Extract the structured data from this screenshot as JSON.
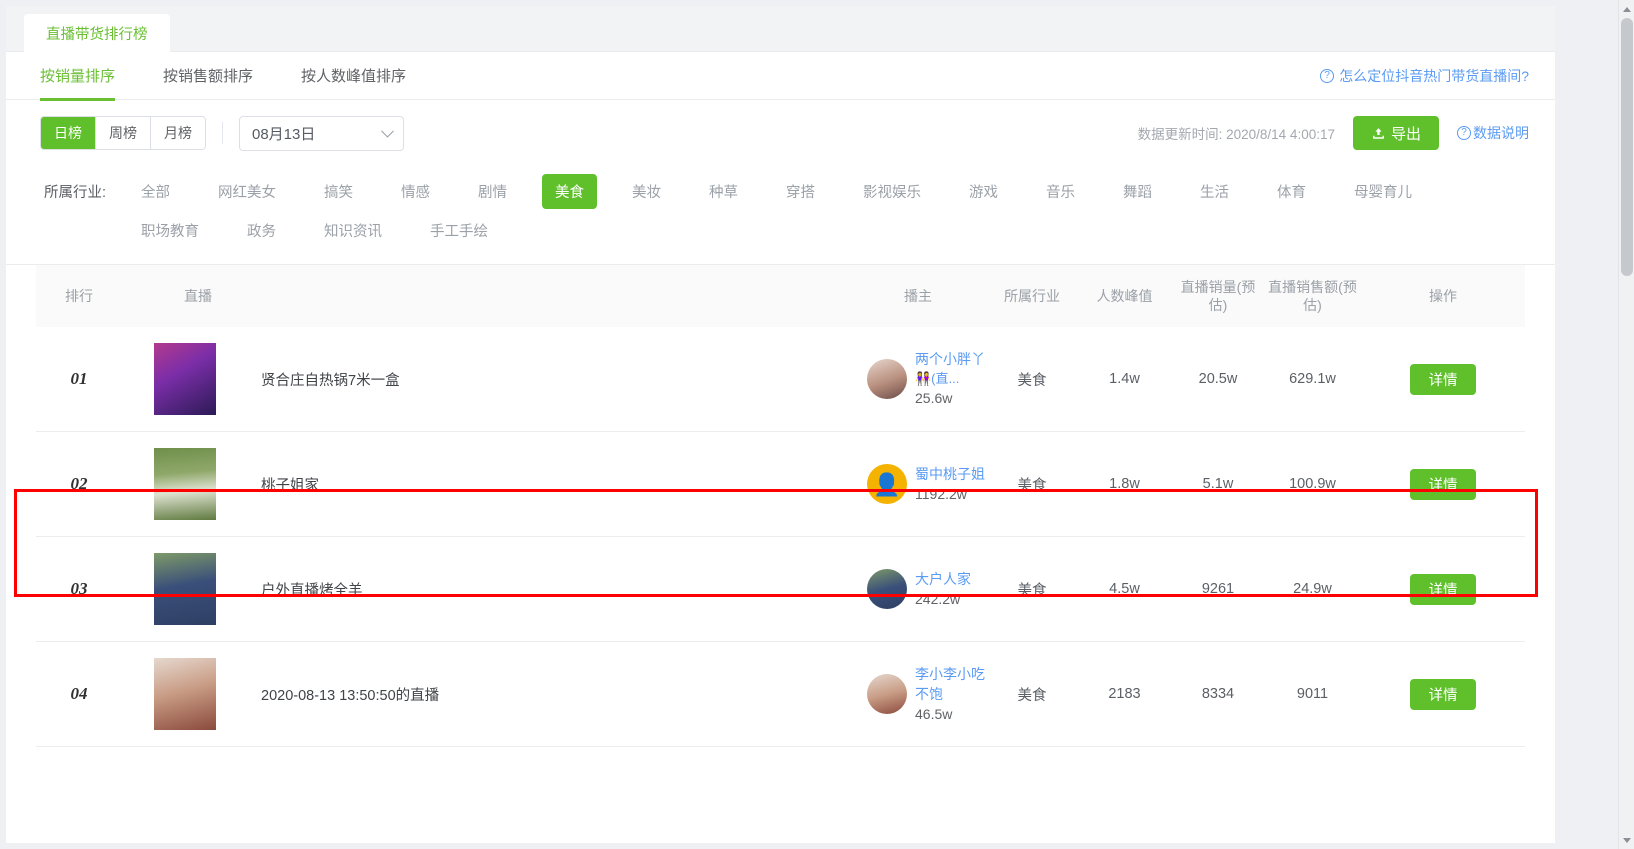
{
  "tab": {
    "label": "直播带货排行榜"
  },
  "sort_tabs": [
    {
      "label": "按销量排序",
      "active": true
    },
    {
      "label": "按销售额排序",
      "active": false
    },
    {
      "label": "按人数峰值排序",
      "active": false
    }
  ],
  "help_link": {
    "icon": "question-circle-icon",
    "label": "怎么定位抖音热门带货直播间?"
  },
  "period": {
    "options": [
      "日榜",
      "周榜",
      "月榜"
    ],
    "selected": "日榜"
  },
  "date_select": {
    "value": "08月13日",
    "icon": "chevron-down-icon"
  },
  "update_time": {
    "label": "数据更新时间:",
    "value": "2020/8/14 4:00:17"
  },
  "export_button": {
    "label": "导出",
    "icon": "upload-icon"
  },
  "data_note": {
    "label": "数据说明",
    "icon": "question-circle-icon"
  },
  "industry_filter": {
    "label": "所属行业:",
    "selected": "美食",
    "items": [
      "全部",
      "网红美女",
      "搞笑",
      "情感",
      "剧情",
      "美食",
      "美妆",
      "种草",
      "穿搭",
      "影视娱乐",
      "游戏",
      "音乐",
      "舞蹈",
      "生活",
      "体育",
      "母婴育儿",
      "职场教育",
      "政务",
      "知识资讯",
      "手工手绘"
    ]
  },
  "table": {
    "headers": {
      "rank": "排行",
      "live": "直播",
      "host": "播主",
      "industry": "所属行业",
      "peak": "人数峰值",
      "volume": "直播销量(预估)",
      "sales": "直播销售额(预估)",
      "action": "操作"
    },
    "action_label": "详情",
    "rows": [
      {
        "rank": "01",
        "title": "贤合庄自热锅7米一盒",
        "host_name": "两个小胖丫",
        "host_extra": "👭(直...",
        "host_fans": "25.6w",
        "industry": "美食",
        "peak": "1.4w",
        "volume": "20.5w",
        "sales": "629.1w",
        "highlighted": false
      },
      {
        "rank": "02",
        "title": "桃子姐家",
        "host_name": "蜀中桃子姐",
        "host_extra": "",
        "host_fans": "1192.2w",
        "industry": "美食",
        "peak": "1.8w",
        "volume": "5.1w",
        "sales": "100.9w",
        "highlighted": true
      },
      {
        "rank": "03",
        "title": "户外直播烤全羊",
        "host_name": "大户人家",
        "host_extra": "",
        "host_fans": "242.2w",
        "industry": "美食",
        "peak": "4.5w",
        "volume": "9261",
        "sales": "24.9w",
        "highlighted": false
      },
      {
        "rank": "04",
        "title": "2020-08-13 13:50:50的直播",
        "host_name": "李小李小吃",
        "host_extra": "不饱",
        "host_fans": "46.5w",
        "industry": "美食",
        "peak": "2183",
        "volume": "8334",
        "sales": "9011",
        "highlighted": false
      }
    ]
  },
  "colors": {
    "brand_green": "#5fc02b",
    "link_blue": "#5b9bf3",
    "highlight_red": "#ff0000"
  }
}
